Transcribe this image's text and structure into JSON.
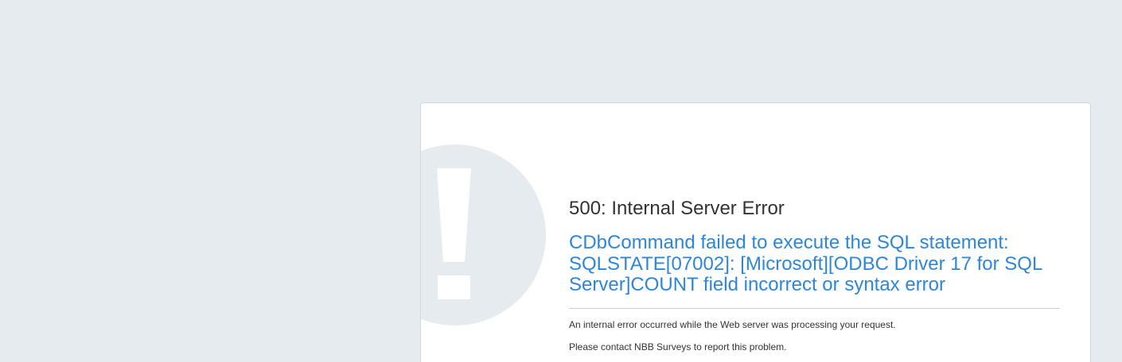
{
  "colors": {
    "page_background": "#e6ebef",
    "card_background": "#ffffff",
    "accent_blue": "#2f86d6",
    "alert_graphic": "#e6ebef",
    "text": "#333333"
  },
  "error": {
    "icon": "exclamation-icon",
    "status_title": "500: Internal Server Error",
    "message": "CDbCommand failed to execute the SQL statement: SQLSTATE[07002]: [Microsoft][ODBC Driver 17 for SQL Server]COUNT field incorrect or syntax error",
    "info": "An internal error occurred while the Web server was processing your request.",
    "contact": "Please contact NBB Surveys to report this problem."
  }
}
